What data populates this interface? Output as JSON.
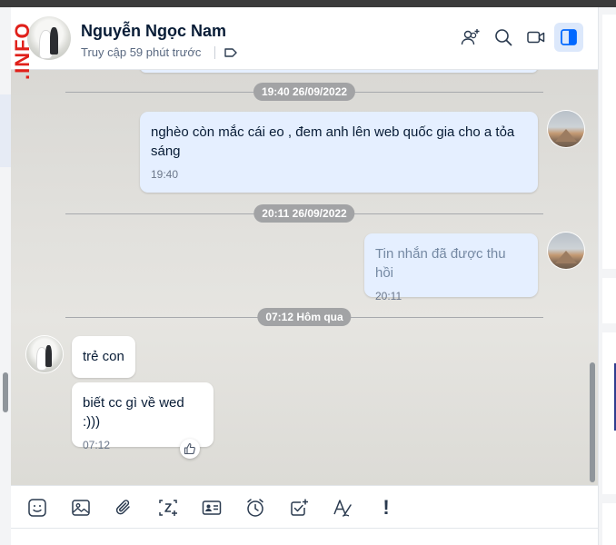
{
  "watermark": ".INFO",
  "header": {
    "contact_name": "Nguyễn Ngọc Nam",
    "status": "Truy cập 59 phút trước",
    "icons": [
      "add-member-icon",
      "search-icon",
      "video-call-icon",
      "sidebar-toggle-icon"
    ]
  },
  "messages": {
    "sep1": "19:40 26/09/2022",
    "msg1_text": "nghèo còn mắc cái eo , đem anh lên web quốc gia cho a tỏa sáng",
    "msg1_time": "19:40",
    "sep2": "20:11 26/09/2022",
    "msg2_text": "Tin nhắn đã được thu hồi",
    "msg2_time": "20:11",
    "sep3": "07:12 Hôm qua",
    "msg3_text": "trẻ con",
    "msg4_text": "biết cc gì về wed :)))",
    "msg4_time": "07:12"
  },
  "toolbar": {
    "icons": [
      "sticker-icon",
      "image-icon",
      "attachment-icon",
      "screenshot-icon",
      "contact-card-icon",
      "reminder-icon",
      "todo-icon",
      "text-format-icon",
      "important-icon"
    ],
    "important_label": "!"
  },
  "colors": {
    "my_bubble": "#e5efff",
    "their_bubble": "#ffffff",
    "accent": "#0068ff",
    "separator_pill": "#a2a3a5"
  }
}
